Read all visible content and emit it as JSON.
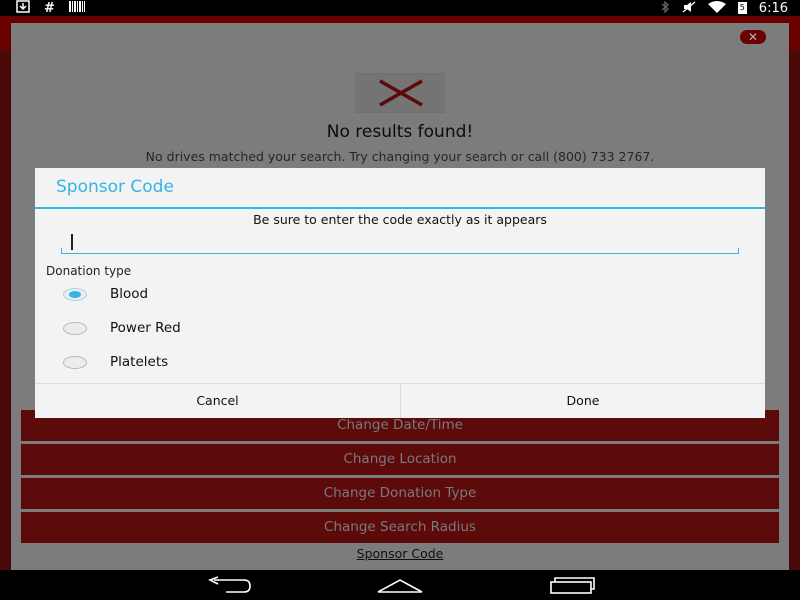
{
  "status_bar": {
    "left_icons": [
      "download-icon",
      "hash-icon",
      "barcode-icon"
    ],
    "right_icons": [
      "bluetooth-icon",
      "mute-icon",
      "wifi-icon",
      "battery-icon"
    ],
    "battery_level": "5",
    "time": "6:16"
  },
  "page": {
    "close_label": "✕",
    "no_results_title": "No results found!",
    "no_results_message": "No drives matched your search. Try changing your search or call (800) 733 2767.",
    "buttons": [
      "Change Date/Time",
      "Change Location",
      "Change Donation Type",
      "Change Search Radius"
    ],
    "sponsor_link": "Sponsor Code"
  },
  "dialog": {
    "title": "Sponsor Code",
    "hint": "Be sure to enter the code exactly as it appears",
    "input_value": "",
    "donation_type_label": "Donation type",
    "options": [
      {
        "label": "Blood",
        "checked": true
      },
      {
        "label": "Power Red",
        "checked": false
      },
      {
        "label": "Platelets",
        "checked": false
      }
    ],
    "cancel_label": "Cancel",
    "done_label": "Done"
  },
  "colors": {
    "accent": "#33b5e5",
    "brand_red": "#5d0a0a"
  },
  "nav_bar": {
    "icons": [
      "back-icon",
      "home-icon",
      "recents-icon"
    ]
  }
}
